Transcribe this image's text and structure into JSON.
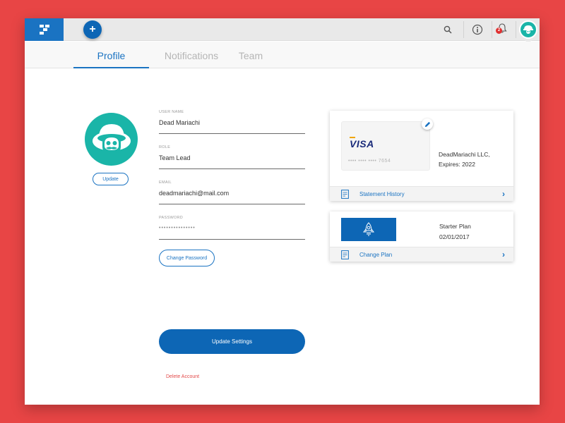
{
  "topbar": {
    "logo_icon": "brand-logo-icon",
    "add_label": "+",
    "icons": [
      "search-icon",
      "info-icon",
      "bell-icon",
      "user-avatar"
    ],
    "notification_count": "2"
  },
  "tabs": [
    {
      "label": "Profile",
      "active": true
    },
    {
      "label": "Notifications",
      "active": false
    },
    {
      "label": "Team",
      "active": false
    }
  ],
  "profile": {
    "avatar_icon": "mariachi-skull-avatar",
    "update_label": "Update"
  },
  "form": {
    "username": {
      "label": "USER NAME",
      "value": "Dead Mariachi"
    },
    "role": {
      "label": "ROLE",
      "value": "Team Lead"
    },
    "email": {
      "label": "EMAIL",
      "value": "deadmariachi@mail.com"
    },
    "password": {
      "label": "PASSWORD",
      "value": "•••••••••••••••"
    },
    "change_password_label": "Change Password",
    "update_settings_label": "Update Settings",
    "delete_account_label": "Delete Account"
  },
  "billing": {
    "card_brand": "VISA",
    "card_number": "•••• •••• •••• 7654",
    "company": "DeadMariachi LLC,",
    "expires": "Expires: 2022",
    "statement_label": "Statement History"
  },
  "plan": {
    "name": "Starter Plan",
    "date": "02/01/2017",
    "change_label": "Change Plan"
  },
  "colors": {
    "background": "#e84545",
    "primary": "#1a73c2",
    "teal": "#1ab5a8",
    "danger": "#e34b4b"
  }
}
